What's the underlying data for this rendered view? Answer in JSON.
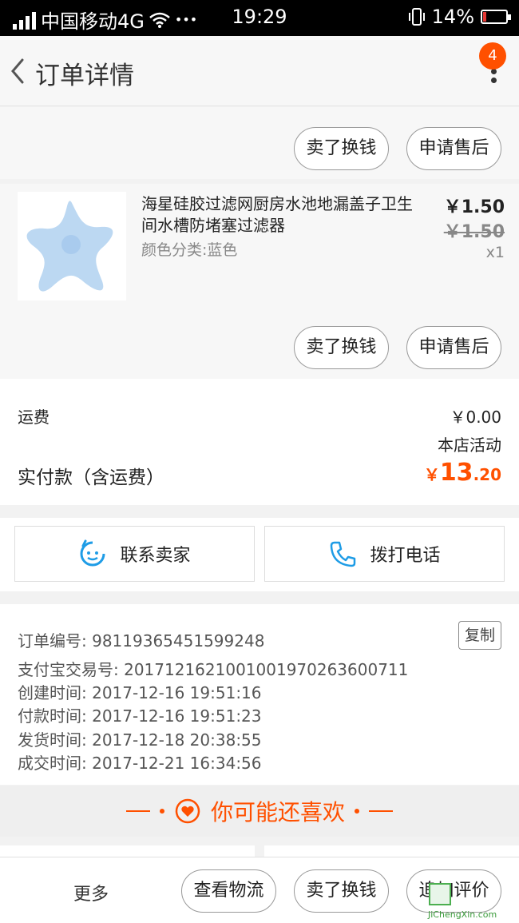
{
  "status_bar": {
    "carrier": "中国移动4G",
    "ellipsis": "•••",
    "time": "19:29",
    "battery": "14%"
  },
  "nav": {
    "title": "订单详情",
    "badge_count": "4"
  },
  "top_actions": {
    "sell_label": "卖了换钱",
    "after_sale_label": "申请售后"
  },
  "product": {
    "name": "海星硅胶过滤网厨房水池地漏盖子卫生间水槽防堵塞过滤器",
    "spec": "颜色分类:蓝色",
    "price": "￥1.50",
    "original_price": "￥1.50",
    "quantity": "x1",
    "image_icon": "starfish-filter-image",
    "sell_label": "卖了换钱",
    "after_sale_label": "申请售后"
  },
  "summary": {
    "shipping_label": "运费",
    "shipping_value": "￥0.00",
    "promo_label": "本店活动",
    "total_label": "实付款（含运费）",
    "total_currency": "￥",
    "total_int": "13",
    "total_dec": ".20",
    "accent_color": "#ff5000"
  },
  "contact": {
    "seller_label": "联系卖家",
    "phone_label": "拨打电话",
    "icon_color": "#1e9ce6"
  },
  "order_info": {
    "order_no": "订单编号: 98119365451599248",
    "alipay_no": "支付宝交易号: 2017121621001001970263600711",
    "created": "创建时间: 2017-12-16 19:51:16",
    "paid": "付款时间: 2017-12-16 19:51:23",
    "shipped": "发货时间: 2017-12-18 20:38:55",
    "completed": "成交时间: 2017-12-21 16:34:56",
    "copy_label": "复制"
  },
  "recommend": {
    "label": "你可能还喜欢"
  },
  "bottom_bar": {
    "more_label": "更多",
    "logistics_label": "查看物流",
    "sell_label": "卖了换钱",
    "review_label": "追加评价"
  },
  "watermark": {
    "text": "JiChengXin.com"
  }
}
